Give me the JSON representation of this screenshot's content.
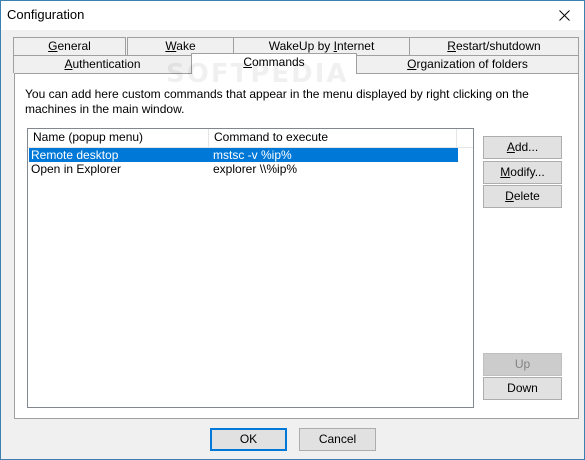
{
  "window": {
    "title": "Configuration"
  },
  "tabs": {
    "row1": [
      {
        "label": "General",
        "accel": "G",
        "rest": "eneral"
      },
      {
        "label": "Wake",
        "accel": "W",
        "rest": "ake"
      },
      {
        "label": "WakeUp by Internet",
        "pre": "WakeUp by ",
        "accel": "I",
        "rest": "nternet"
      },
      {
        "label": "Restart/shutdown",
        "accel": "R",
        "rest": "estart/shutdown"
      }
    ],
    "row2": [
      {
        "label": "Authentication",
        "pre": "",
        "accel": "A",
        "rest": "uthentication"
      },
      {
        "label": "Commands",
        "pre": "",
        "accel": "C",
        "rest": "ommands"
      },
      {
        "label": "Organization of folders",
        "pre": "",
        "accel": "O",
        "rest": "rganization of folders"
      }
    ],
    "active": "Commands"
  },
  "commands_panel": {
    "description": "You can add here custom commands that appear in the menu displayed by right clicking on the machines in the main window.",
    "columns": [
      "Name (popup menu)",
      "Command to execute"
    ],
    "rows": [
      {
        "name": "Remote desktop",
        "command": "mstsc -v %ip%",
        "selected": true
      },
      {
        "name": "Open in Explorer",
        "command": "explorer \\\\%ip%",
        "selected": false
      }
    ],
    "buttons": {
      "add": "Add...",
      "modify": "Modify...",
      "delete": "Delete",
      "up": "Up",
      "down": "Down"
    }
  },
  "footer": {
    "ok": "OK",
    "cancel": "Cancel"
  },
  "watermark": "SOFTPEDIA",
  "colors": {
    "selection": "#0078d7",
    "window_border": "#3c7fb1",
    "dialog_bg": "#f0f0f0"
  }
}
